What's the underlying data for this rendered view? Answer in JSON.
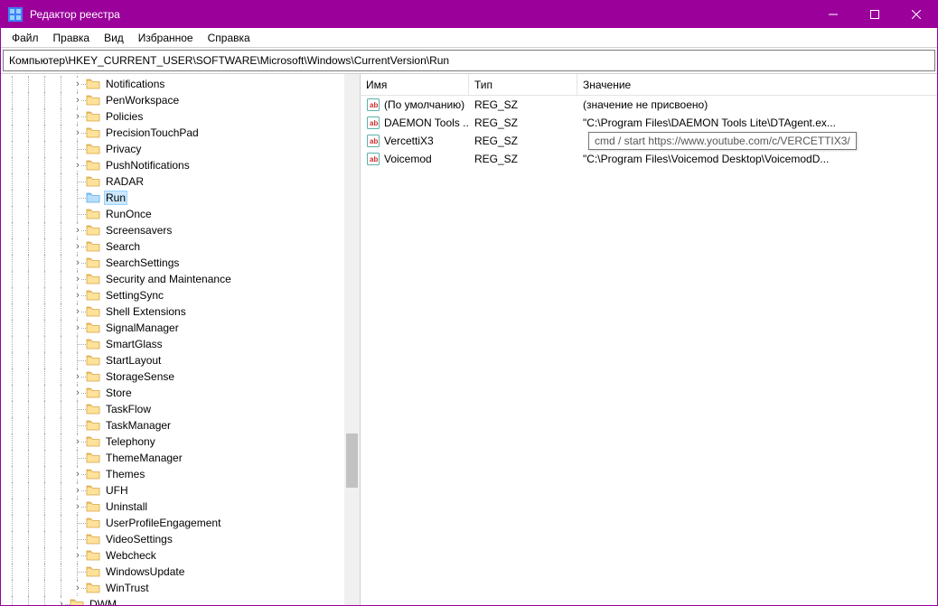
{
  "window": {
    "title": "Редактор реестра"
  },
  "menu": {
    "file": "Файл",
    "edit": "Правка",
    "view": "Вид",
    "favorites": "Избранное",
    "help": "Справка"
  },
  "address": "Компьютер\\HKEY_CURRENT_USER\\SOFTWARE\\Microsoft\\Windows\\CurrentVersion\\Run",
  "columns": {
    "name": "Имя",
    "type": "Тип",
    "value": "Значение"
  },
  "tree": [
    {
      "label": "Notifications",
      "exp": ">",
      "depth": 5
    },
    {
      "label": "PenWorkspace",
      "exp": ">",
      "depth": 5
    },
    {
      "label": "Policies",
      "exp": ">",
      "depth": 5
    },
    {
      "label": "PrecisionTouchPad",
      "exp": ">",
      "depth": 5
    },
    {
      "label": "Privacy",
      "exp": "",
      "depth": 5
    },
    {
      "label": "PushNotifications",
      "exp": ">",
      "depth": 5
    },
    {
      "label": "RADAR",
      "exp": "",
      "depth": 5
    },
    {
      "label": "Run",
      "exp": "",
      "depth": 5,
      "selected": true
    },
    {
      "label": "RunOnce",
      "exp": "",
      "depth": 5
    },
    {
      "label": "Screensavers",
      "exp": ">",
      "depth": 5
    },
    {
      "label": "Search",
      "exp": ">",
      "depth": 5
    },
    {
      "label": "SearchSettings",
      "exp": ">",
      "depth": 5
    },
    {
      "label": "Security and Maintenance",
      "exp": ">",
      "depth": 5
    },
    {
      "label": "SettingSync",
      "exp": ">",
      "depth": 5
    },
    {
      "label": "Shell Extensions",
      "exp": ">",
      "depth": 5
    },
    {
      "label": "SignalManager",
      "exp": ">",
      "depth": 5
    },
    {
      "label": "SmartGlass",
      "exp": "",
      "depth": 5
    },
    {
      "label": "StartLayout",
      "exp": "",
      "depth": 5
    },
    {
      "label": "StorageSense",
      "exp": ">",
      "depth": 5
    },
    {
      "label": "Store",
      "exp": ">",
      "depth": 5
    },
    {
      "label": "TaskFlow",
      "exp": "",
      "depth": 5
    },
    {
      "label": "TaskManager",
      "exp": "",
      "depth": 5
    },
    {
      "label": "Telephony",
      "exp": ">",
      "depth": 5
    },
    {
      "label": "ThemeManager",
      "exp": "",
      "depth": 5
    },
    {
      "label": "Themes",
      "exp": ">",
      "depth": 5
    },
    {
      "label": "UFH",
      "exp": ">",
      "depth": 5
    },
    {
      "label": "Uninstall",
      "exp": ">",
      "depth": 5
    },
    {
      "label": "UserProfileEngagement",
      "exp": "",
      "depth": 5
    },
    {
      "label": "VideoSettings",
      "exp": "",
      "depth": 5
    },
    {
      "label": "Webcheck",
      "exp": ">",
      "depth": 5
    },
    {
      "label": "WindowsUpdate",
      "exp": "",
      "depth": 5
    },
    {
      "label": "WinTrust",
      "exp": ">",
      "depth": 5
    },
    {
      "label": "DWM",
      "exp": ">",
      "depth": 4
    }
  ],
  "values": [
    {
      "name": "(По умолчанию)",
      "type": "REG_SZ",
      "data": "(значение не присвоено)"
    },
    {
      "name": "DAEMON Tools ...",
      "type": "REG_SZ",
      "data": "\"C:\\Program Files\\DAEMON Tools Lite\\DTAgent.ex..."
    },
    {
      "name": "VercettiX3",
      "type": "REG_SZ",
      "data": ""
    },
    {
      "name": "Voicemod",
      "type": "REG_SZ",
      "data": "\"C:\\Program Files\\Voicemod Desktop\\VoicemodD..."
    }
  ],
  "tooltip": "cmd / start https://www.youtube.com/c/VERCETTIX3/"
}
